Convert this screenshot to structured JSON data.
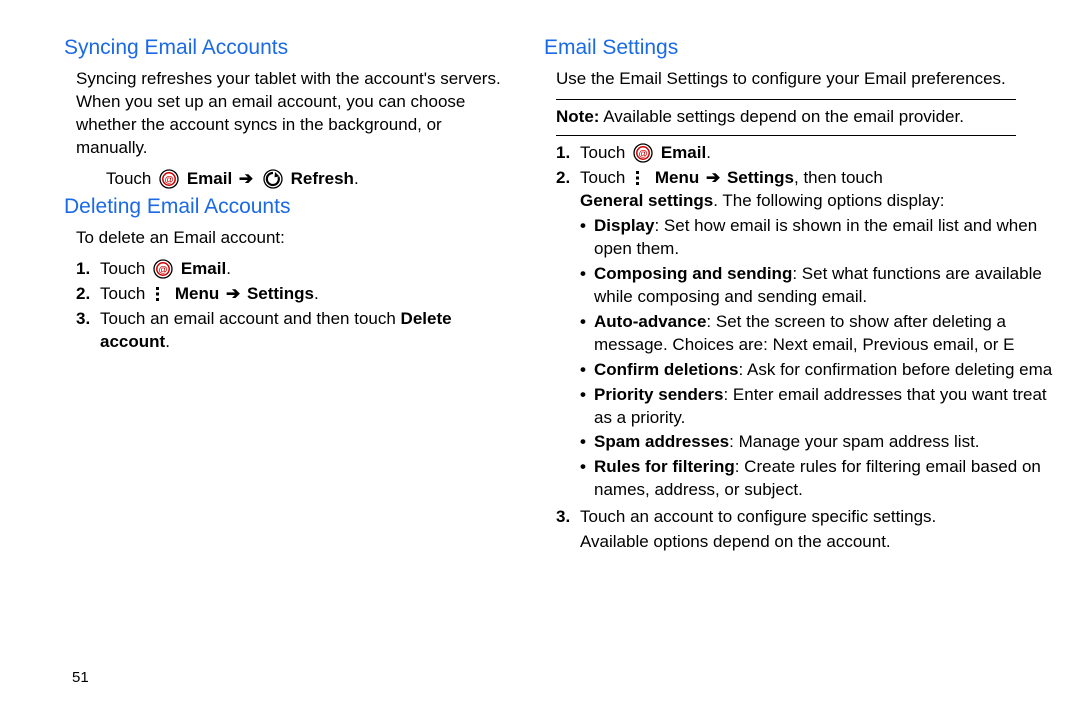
{
  "pageNumber": "51",
  "left": {
    "sync": {
      "heading": "Syncing Email Accounts",
      "body": "Syncing refreshes your tablet with the account's servers. When you set up an email account, you can choose whether the account syncs in the background, or manually.",
      "touchPrefix": "Touch ",
      "emailLabel": "Email",
      "refreshLabel": "Refresh",
      "arrow": "➔",
      "period": "."
    },
    "delete": {
      "heading": "Deleting Email Accounts",
      "intro": "To delete an Email account:",
      "step1_num": "1.",
      "step1_touch": "Touch ",
      "step1_email": "Email",
      "step1_period": ".",
      "step2_num": "2.",
      "step2_touch": "Touch ",
      "step2_menu": "Menu",
      "step2_arrow": "➔",
      "step2_settings": "Settings",
      "step2_period": ".",
      "step3_num": "3.",
      "step3_a": "Touch an email account and then touch ",
      "step3_bold": "Delete account",
      "step3_period": "."
    }
  },
  "right": {
    "heading": "Email Settings",
    "intro": "Use the Email Settings to configure your Email preferences.",
    "noteLabel": "Note:",
    "noteText": " Available settings depend on the email provider.",
    "step1_num": "1.",
    "step1_touch": "Touch ",
    "step1_email": "Email",
    "step1_period": ".",
    "step2_num": "2.",
    "step2_touch": "Touch ",
    "step2_menu": "Menu",
    "step2_arrow": "➔",
    "step2_settings": "Settings",
    "step2_then": ", then touch ",
    "step2_general": "General settings",
    "step2_tail": ". The following options display:",
    "b1_bold": "Display",
    "b1_text": ": Set how email is shown in the email list and when open them.",
    "b2_bold": "Composing and sending",
    "b2_text": ": Set what functions are available while composing and sending email.",
    "b3_bold": "Auto-advance",
    "b3_text": ": Set the screen to show after deleting a message. Choices are: Next email, Previous email, or E",
    "b4_bold": "Confirm deletions",
    "b4_text": ": Ask for confirmation before deleting ema",
    "b5_bold": "Priority senders",
    "b5_text": ": Enter email addresses that you want treat as a priority.",
    "b6_bold": "Spam addresses",
    "b6_text": ": Manage your spam address list.",
    "b7_bold": "Rules for filtering",
    "b7_text": ": Create rules for filtering email based on names, address, or subject.",
    "step3_num": "3.",
    "step3_text": "Touch an account to configure specific settings.",
    "avail": "Available options depend on the account."
  }
}
